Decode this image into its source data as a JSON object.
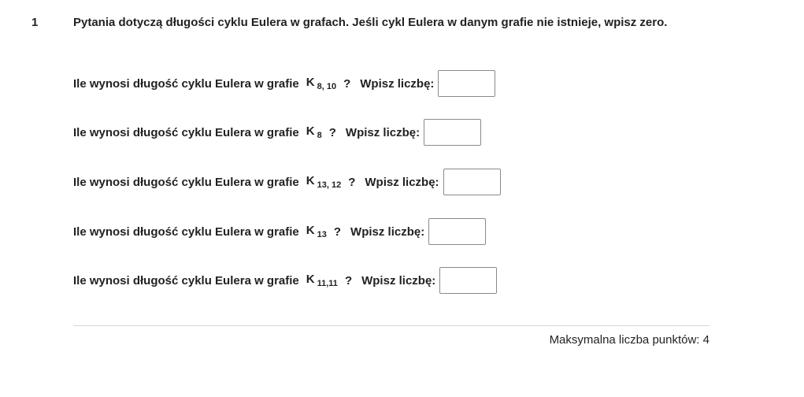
{
  "question": {
    "number": "1",
    "intro": "Pytania dotyczą długości cyklu Eulera w grafach. Jeśli cykl Eulera w danym grafie nie istnieje, wpisz zero."
  },
  "subquestions": [
    {
      "text": "Ile wynosi długość cyklu Eulera w grafie",
      "graph": "K",
      "sub": "8, 10",
      "qmark": "?",
      "prompt": "Wpisz liczbę:",
      "answer": ""
    },
    {
      "text": "Ile wynosi długość cyklu Eulera w grafie",
      "graph": "K",
      "sub": "8",
      "qmark": "?",
      "prompt": "Wpisz liczbę:",
      "answer": ""
    },
    {
      "text": "Ile wynosi długość cyklu Eulera w grafie",
      "graph": "K",
      "sub": "13, 12",
      "qmark": "?",
      "prompt": "Wpisz liczbę:",
      "answer": ""
    },
    {
      "text": "Ile wynosi długość cyklu Eulera w grafie",
      "graph": "K",
      "sub": "13",
      "qmark": "?",
      "prompt": "Wpisz liczbę:",
      "answer": ""
    },
    {
      "text": "Ile wynosi długość cyklu Eulera w grafie",
      "graph": "K",
      "sub": "11,11",
      "qmark": "?",
      "prompt": "Wpisz liczbę:",
      "answer": ""
    }
  ],
  "footer": {
    "max_points": "Maksymalna liczba punktów: 4"
  }
}
